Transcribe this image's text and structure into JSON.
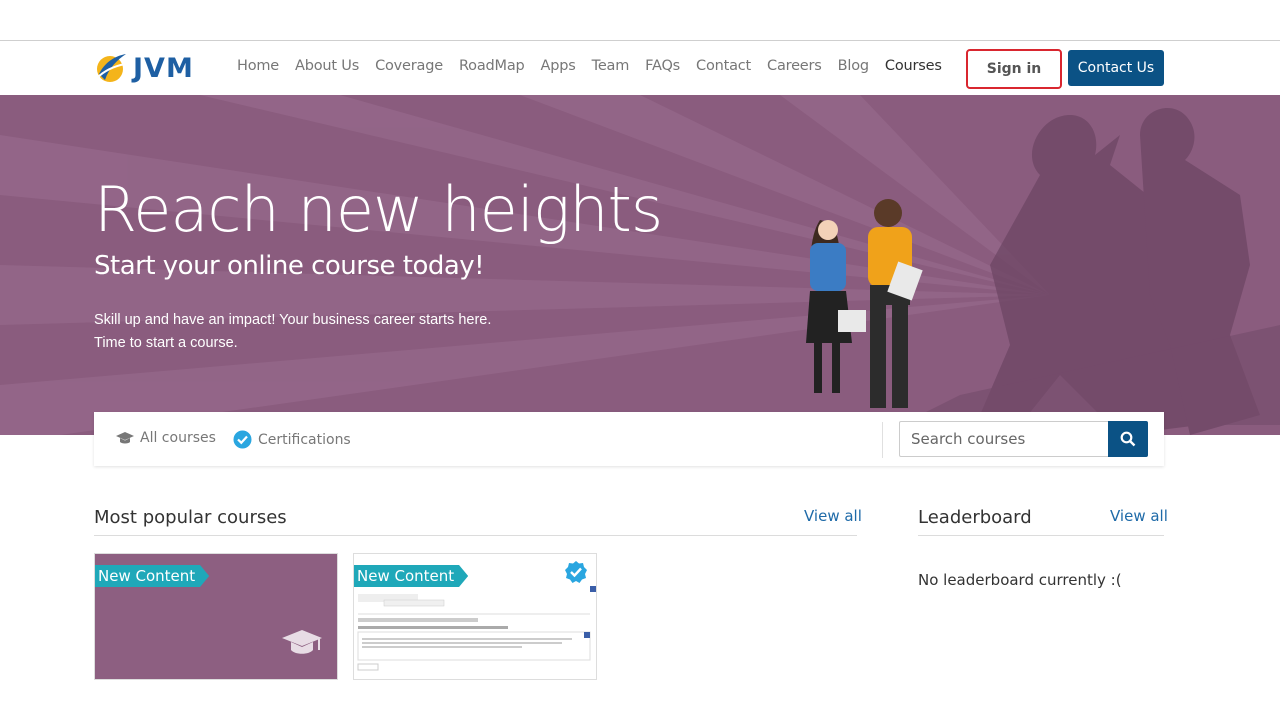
{
  "brand": {
    "name": "JVM"
  },
  "nav": {
    "links": [
      "Home",
      "About Us",
      "Coverage",
      "RoadMap",
      "Apps",
      "Team",
      "FAQs",
      "Contact",
      "Careers",
      "Blog",
      "Courses"
    ],
    "active": "Courses",
    "sign_in": "Sign in",
    "contact_us": "Contact Us"
  },
  "hero": {
    "title": "Reach new heights",
    "subtitle": "Start your online course today!",
    "line1": "Skill up and have an impact! Your business career starts here.",
    "line2": "Time to start a course."
  },
  "filters": {
    "all_courses": "All courses",
    "certifications": "Certifications",
    "search_placeholder": "Search courses"
  },
  "popular": {
    "title": "Most popular courses",
    "view_all": "View all",
    "cards": [
      {
        "badge": "New Content",
        "icon": "graduation-cap-icon"
      },
      {
        "badge": "New Content",
        "icon": "verified-check-icon"
      }
    ]
  },
  "leaderboard": {
    "title": "Leaderboard",
    "view_all": "View all",
    "empty": "No leaderboard currently :("
  },
  "colors": {
    "hero_bg": "#8a5c7e",
    "primary": "#0b5285",
    "link": "#1e6aa8",
    "badge": "#1fa8b9",
    "highlight": "#d9262f"
  }
}
